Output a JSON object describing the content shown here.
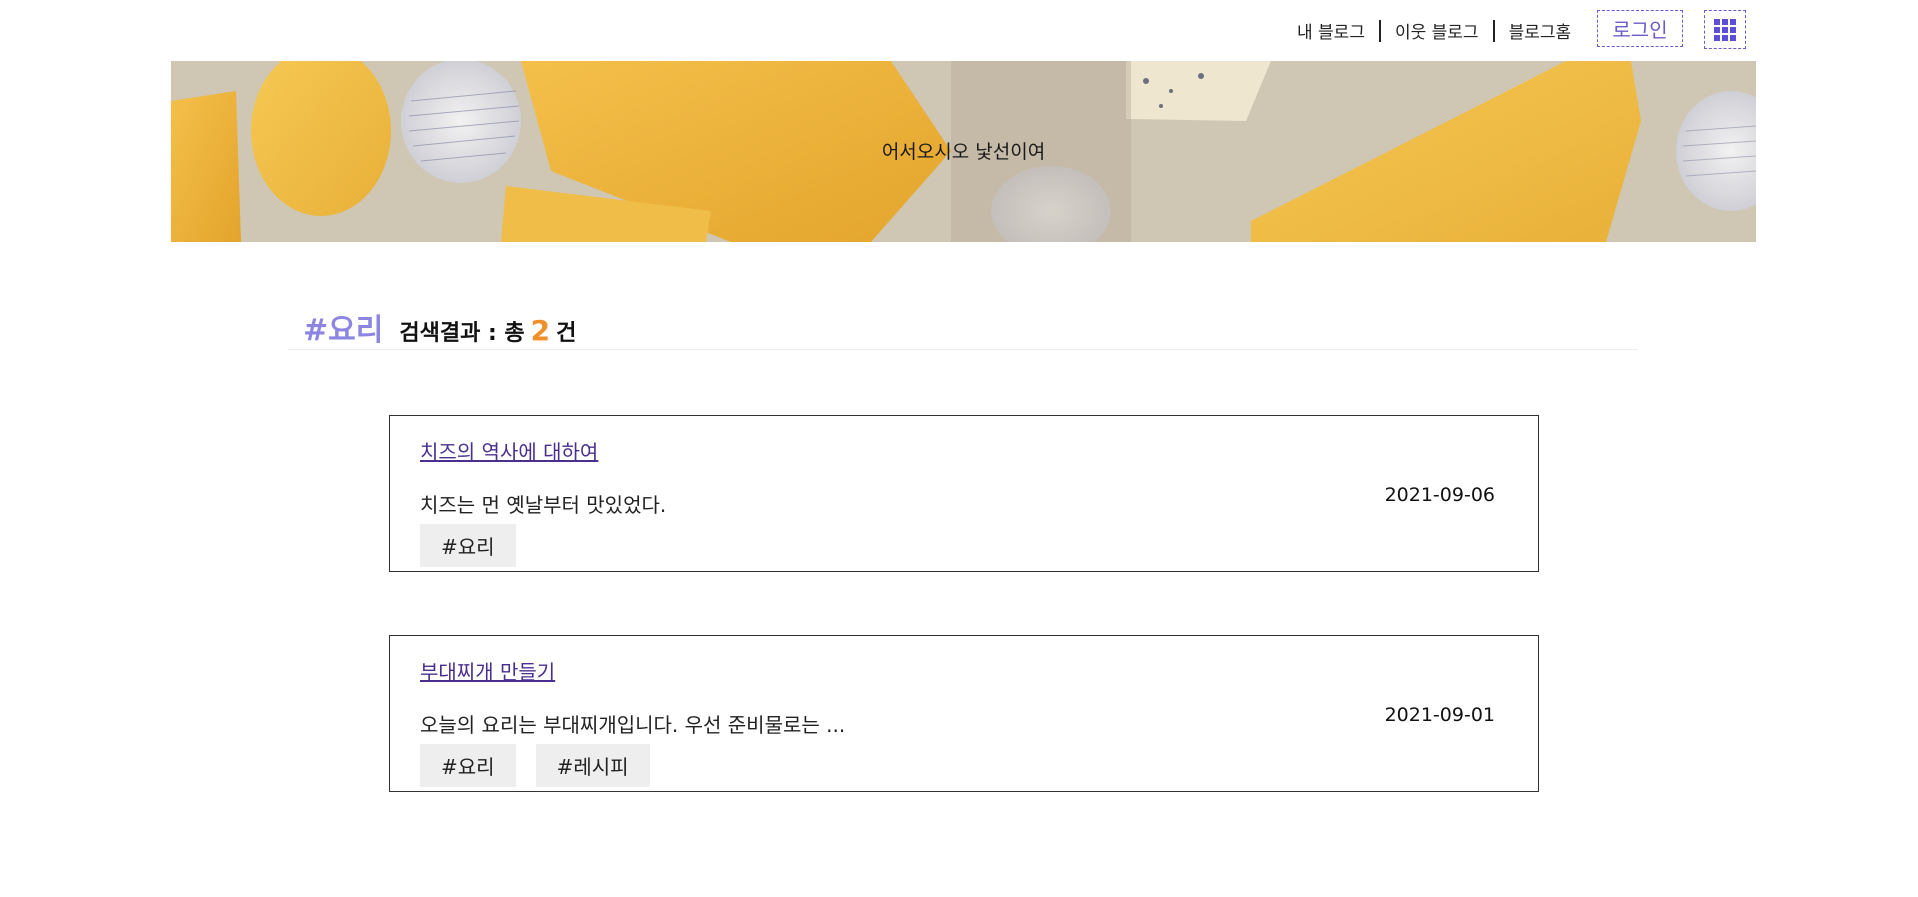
{
  "topnav": {
    "links": [
      "내 블로그",
      "이웃 블로그",
      "블로그홈"
    ],
    "login_label": "로그인",
    "menu_icon": "grid-icon"
  },
  "banner": {
    "welcome_text": "어서오시오 낯선이여"
  },
  "search": {
    "tag": "#요리",
    "result_prefix": "검색결과 : 총",
    "count": "2",
    "result_suffix": "건"
  },
  "posts": [
    {
      "title": "치즈의 역사에 대하여",
      "excerpt": "치즈는 먼 옛날부터 맛있었다.",
      "date": "2021-09-06",
      "tags": [
        "#요리"
      ]
    },
    {
      "title": "부대찌개 만들기",
      "excerpt": "오늘의 요리는 부대찌개입니다. 우선 준비물로는 ...",
      "date": "2021-09-01",
      "tags": [
        "#요리",
        "#레시피"
      ]
    }
  ],
  "colors": {
    "accent": "#6a5cc9",
    "tag_title": "#8c86e2",
    "count": "#f0902a",
    "link": "#4b2f8e"
  }
}
